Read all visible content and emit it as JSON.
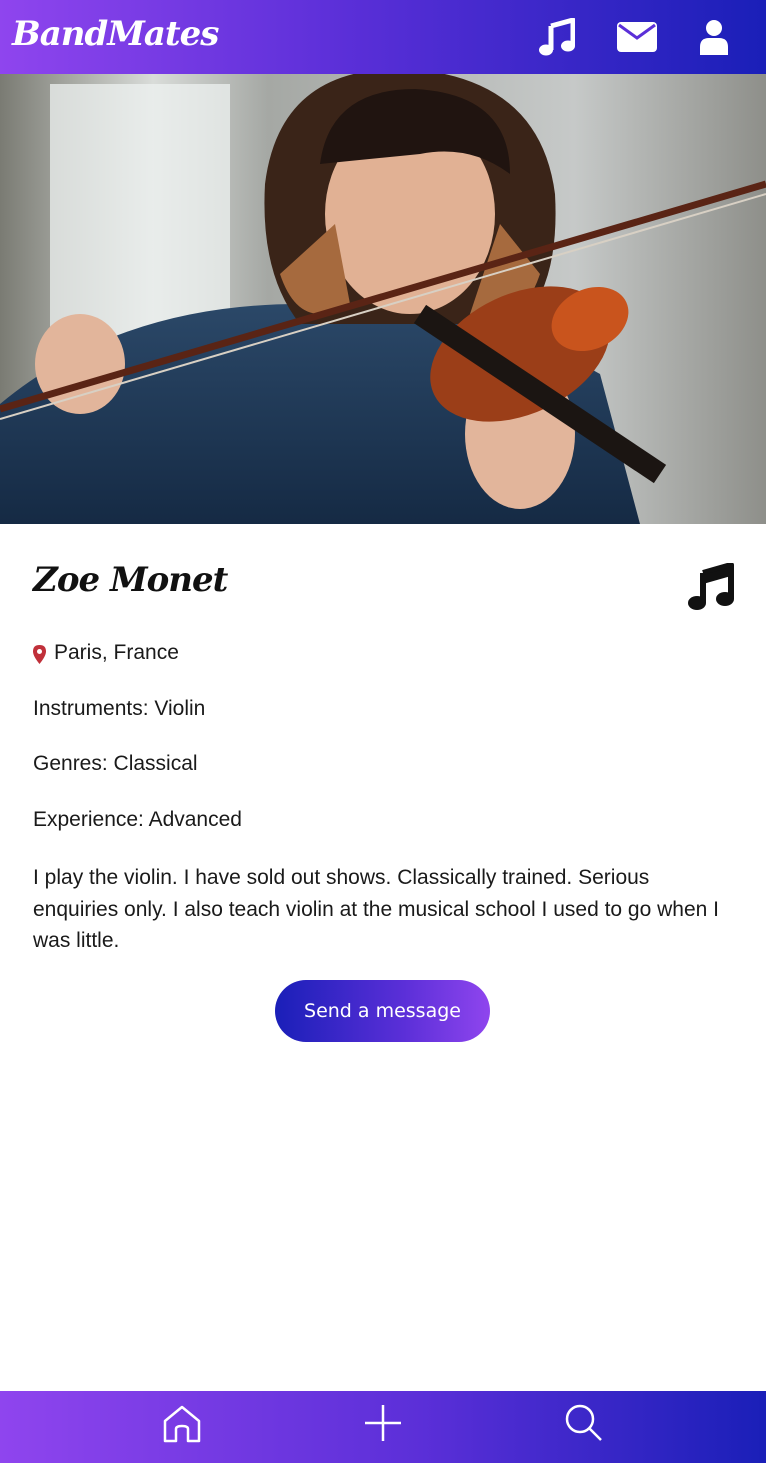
{
  "app": {
    "title": "BandMates"
  },
  "header": {
    "icons": [
      "music-icon",
      "envelope-icon",
      "user-icon"
    ]
  },
  "profile": {
    "name": "Zoe Monet",
    "location": "Paris, France",
    "instruments": "Instruments: Violin",
    "genres": "Genres: Classical",
    "experience": "Experience: Advanced",
    "bio": "I play the violin. I have sold out shows. Classically trained. Serious enquiries only. I also teach violin at the musical school I used to go when I was little.",
    "send_label": "Send a message"
  },
  "footer": {
    "icons": [
      "home-icon",
      "plus-icon",
      "search-icon"
    ]
  },
  "colors": {
    "gradient_start": "#8f45ee",
    "gradient_end": "#1a1fb8",
    "pin": "#c0303a"
  }
}
